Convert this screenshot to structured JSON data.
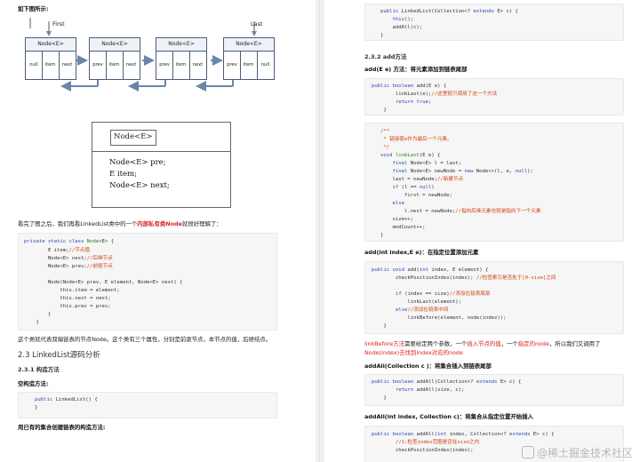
{
  "left": {
    "intro": "如下图所示:",
    "diagram": {
      "first_label": "First",
      "last_label": "Last",
      "nodes": [
        {
          "title": "Node<E>",
          "cells": [
            "null",
            "item",
            "next"
          ]
        },
        {
          "title": "Node<E>",
          "cells": [
            "prev",
            "item",
            "next"
          ]
        },
        {
          "title": "Node<E>",
          "cells": [
            "prev",
            "item",
            "next"
          ]
        },
        {
          "title": "Node<E>",
          "cells": [
            "prev",
            "item",
            "null"
          ]
        }
      ],
      "big_node": {
        "title": "Node<E>",
        "fields": [
          "Node<E> pre;",
          "E item;",
          "Node<E> next;"
        ]
      }
    },
    "after_diagram": {
      "pre": "看完了图之后，我们再看LinkedList类中的一个",
      "highlight": "内部私有类Node",
      "post": "就很好理解了："
    },
    "code1": [
      "private static class Node<E> {",
      "        E item;//节点值",
      "        Node<E> next;//后继节点",
      "        Node<E> prev;//前驱节点",
      "",
      "        Node(Node<E> prev, E element, Node<E> next) {",
      "            this.item = element;",
      "            this.next = next;",
      "            this.prev = prev;",
      "        }",
      "    }"
    ],
    "para1": "这个类就代表双端链表的节点Node。这个类有三个属性，分别是前驱节点，本节点的值，后继结点。",
    "h23": "2.3 LinkedList源码分析",
    "h231": "2.3.1 构造方法",
    "empty_ctor": "空构造方法:",
    "code2": [
      "public LinkedList() {",
      "}"
    ],
    "existing_ctor": "用已有的集合创建链表的构造方法:"
  },
  "right": {
    "code_top": [
      "public LinkedList(Collection<? extends E> c) {",
      "    this();",
      "    addAll(c);",
      "}"
    ],
    "h232": "2.3.2 add方法",
    "add_desc": "add(E e) 方法：将元素添加到链表尾部",
    "code_add": [
      "public boolean add(E e) {",
      "        linkLast(e);//这里就只调用了这一个方法",
      "        return true;",
      "    }"
    ],
    "code_linklast": [
      "/**",
      " * 链接使e作为最后一个元素。",
      " */",
      "void linkLast(E e) {",
      "    final Node<E> l = last;",
      "    final Node<E> newNode = new Node<>(l, e, null);",
      "    last = newNode;//新建节点",
      "    if (l == null)",
      "        first = newNode;",
      "    else",
      "        l.next = newNode;//指向后继元素也就是指向下一个元素",
      "    size++;",
      "    modCount++;",
      "}"
    ],
    "add_index_desc": "add(int index,E e)：在指定位置添加元素",
    "code_add_index": [
      "public void add(int index, E element) {",
      "        checkPositionIndex(index); //检查索引是否处于[0-size]之间",
      "",
      "        if (index == size)//添加在链表尾部",
      "            linkLast(element);",
      "        else//添加在链表中间",
      "            linkBefore(element, node(index));",
      "    }"
    ],
    "para_red_1": "linkBefore方法",
    "para_1": "需要给定两个参数，一个",
    "para_red_2": "插入节点的值",
    "para_2": "，一个",
    "para_red_3": "指定的node",
    "para_3": "，所以我们又调用了",
    "para_red_4": "Node(index)去找到index对应的node",
    "addall_desc": "addAll(Collection c )：将集合插入到链表尾部",
    "code_addall": [
      "public boolean addAll(Collection<? extends E> c) {",
      "        return addAll(size, c);",
      "    }"
    ],
    "addall_index_desc": "addAll(int index, Collection c)：将集合从指定位置开始插入",
    "code_addall_index": [
      "public boolean addAll(int index, Collection<? extends E> c) {",
      "        //1:检查index范围是否在size之内",
      "        checkPositionIndex(index);"
    ]
  },
  "watermark": "@稀土掘金技术社区"
}
